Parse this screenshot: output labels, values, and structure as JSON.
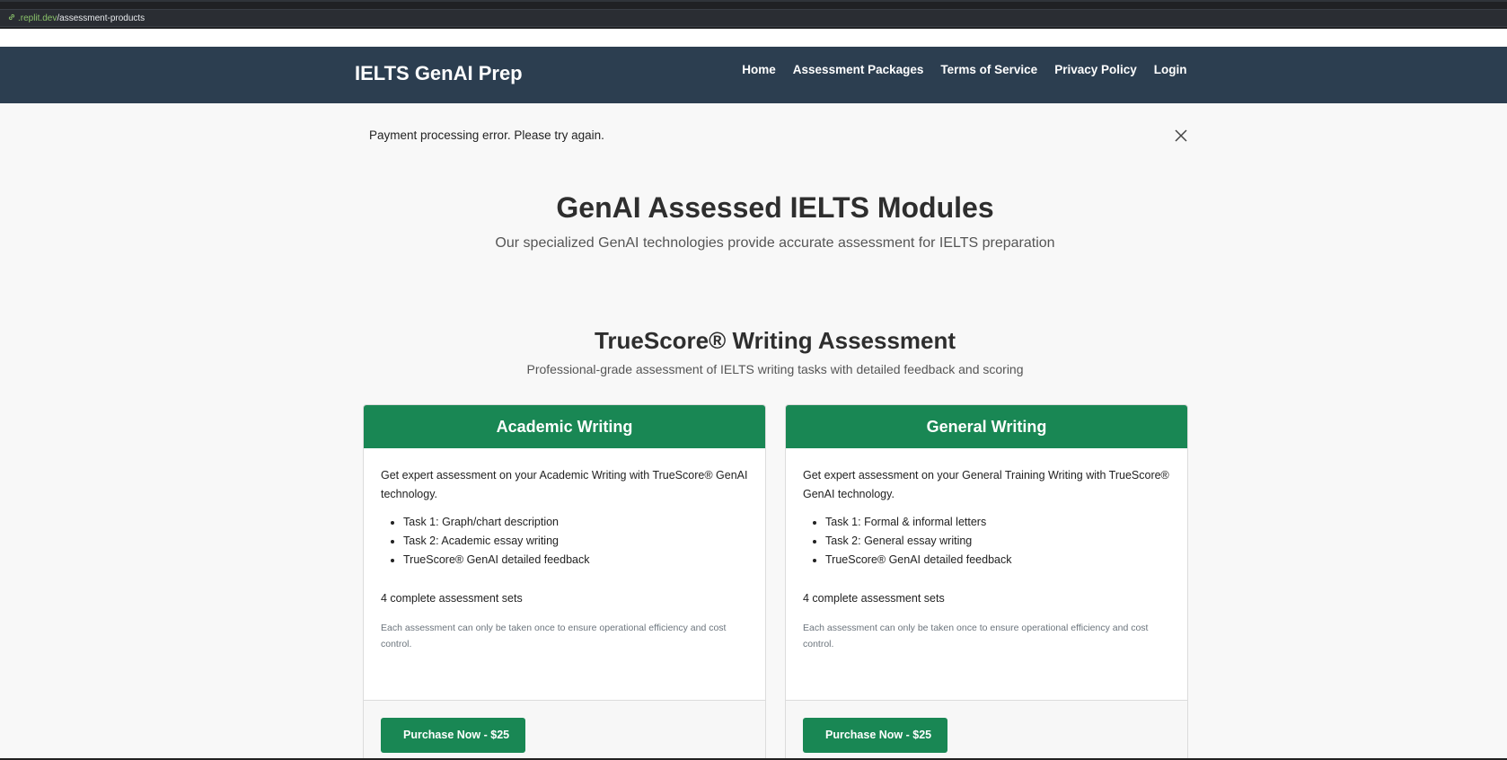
{
  "browser": {
    "url_domain": ".replit.dev",
    "url_path": "/assessment-products"
  },
  "navbar": {
    "brand": "IELTS GenAI Prep",
    "links": [
      "Home",
      "Assessment Packages",
      "Terms of Service",
      "Privacy Policy",
      "Login"
    ]
  },
  "alert": {
    "message": "Payment processing error. Please try again."
  },
  "hero": {
    "title": "GenAI Assessed IELTS Modules",
    "subtitle": "Our specialized GenAI technologies provide accurate assessment for IELTS preparation"
  },
  "section": {
    "title": "TrueScore® Writing Assessment",
    "subtitle": "Professional-grade assessment of IELTS writing tasks with detailed feedback and scoring"
  },
  "cards": [
    {
      "title": "Academic Writing",
      "description": "Get expert assessment on your Academic Writing with TrueScore® GenAI technology.",
      "features": [
        "Task 1: Graph/chart description",
        "Task 2: Academic essay writing",
        "TrueScore® GenAI detailed feedback"
      ],
      "sets": "4 complete assessment sets",
      "note": "Each assessment can only be taken once to ensure operational efficiency and cost control.",
      "button": "Purchase Now - $25"
    },
    {
      "title": "General Writing",
      "description": "Get expert assessment on your General Training Writing with TrueScore® GenAI technology.",
      "features": [
        "Task 1: Formal & informal letters",
        "Task 2: General essay writing",
        "TrueScore® GenAI detailed feedback"
      ],
      "sets": "4 complete assessment sets",
      "note": "Each assessment can only be taken once to ensure operational efficiency and cost control.",
      "button": "Purchase Now - $25"
    }
  ],
  "icons": {
    "url": "link-icon",
    "alert_close": "close-icon"
  },
  "colors": {
    "navbar": "#2c3e50",
    "accent": "#198754",
    "background": "#f8f8f8"
  }
}
